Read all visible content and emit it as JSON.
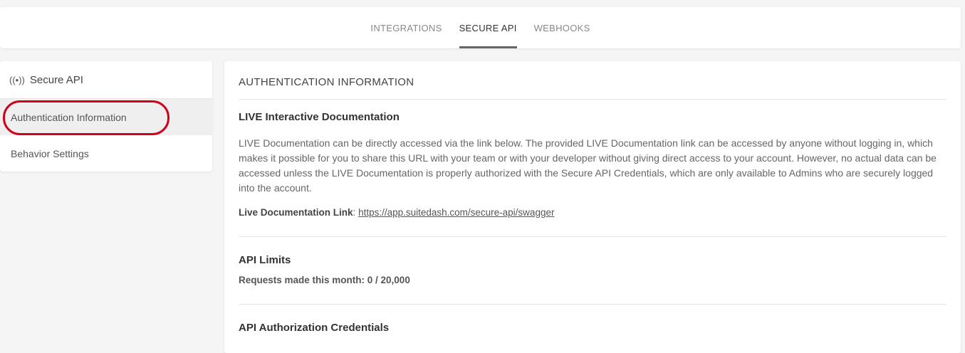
{
  "tabs": [
    {
      "label": "INTEGRATIONS",
      "active": false
    },
    {
      "label": "SECURE API",
      "active": true
    },
    {
      "label": "WEBHOOKS",
      "active": false
    }
  ],
  "sidebar": {
    "header": {
      "icon": "broadcast-icon",
      "label": "Secure API"
    },
    "items": [
      {
        "label": "Authentication Information",
        "active": true
      },
      {
        "label": "Behavior Settings",
        "active": false
      }
    ]
  },
  "main": {
    "title": "AUTHENTICATION INFORMATION",
    "live_docs": {
      "heading": "LIVE Interactive Documentation",
      "description": "LIVE Documentation can be directly accessed via the link below. The provided LIVE Documentation link can be accessed by anyone without logging in, which makes it possible for you to share this URL with your team or with your developer without giving direct access to your account. However, no actual data can be accessed unless the LIVE Documentation is properly authorized with the Secure API Credentials, which are only available to Admins who are securely logged into the account.",
      "link_label": "Live Documentation Link",
      "link_separator": ":",
      "link_url": "https://app.suitedash.com/secure-api/swagger"
    },
    "api_limits": {
      "heading": "API Limits",
      "requests_text": "Requests made this month: 0 / 20,000"
    },
    "credentials": {
      "heading": "API Authorization Credentials"
    }
  },
  "colors": {
    "highlight_ring": "#d0021b",
    "active_tab_underline": "#666666"
  }
}
